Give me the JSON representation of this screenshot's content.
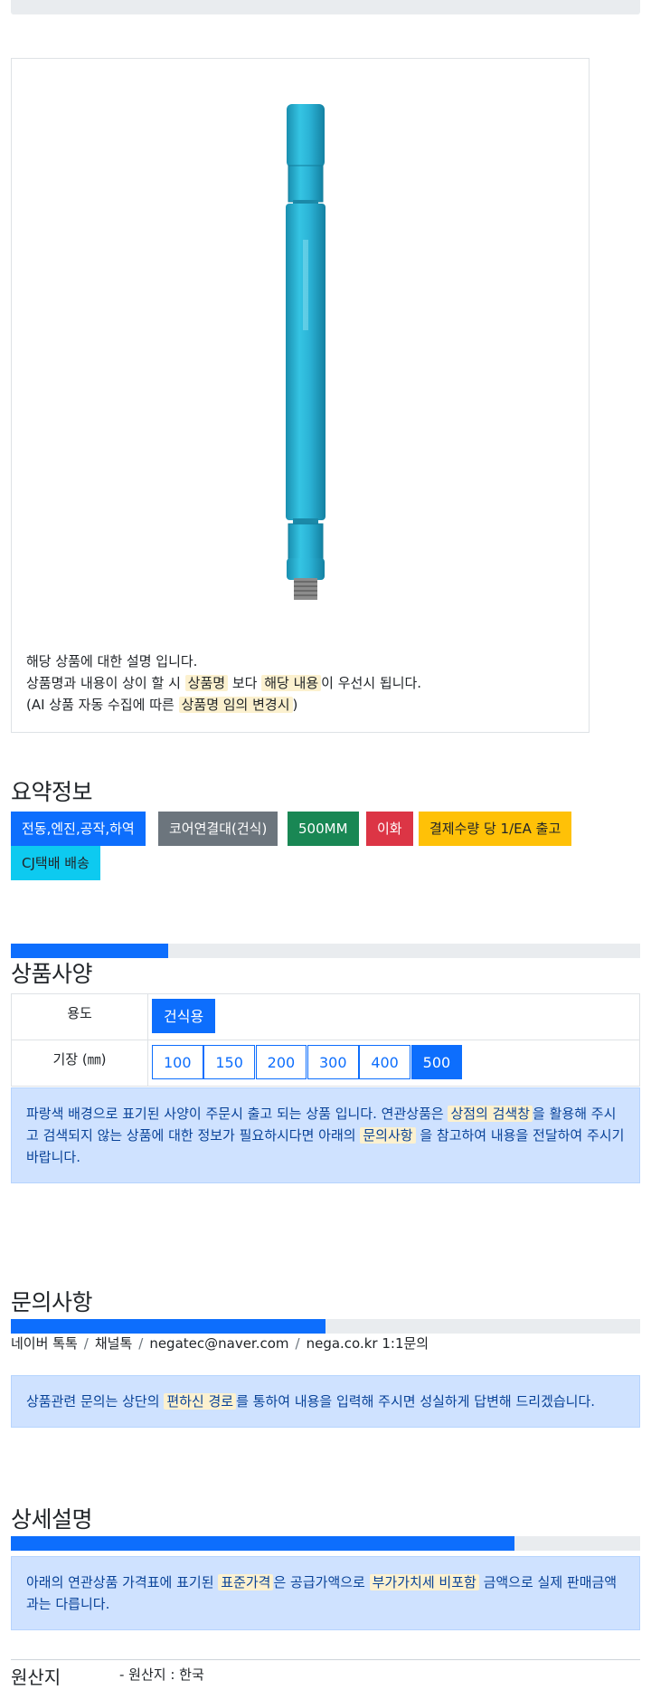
{
  "product_image": {
    "alt": "product-image"
  },
  "description": {
    "line1": "해당 상품에 대한 설명 입니다.",
    "line2_a": "상품명과 내용이 상이 할 시 ",
    "line2_mark1": "상품명",
    "line2_b": " 보다 ",
    "line2_mark2": "해당 내용",
    "line2_c": "이 우선시 됩니다.",
    "line3_a": "(AI 상품 자동 수집에 따른 ",
    "line3_mark": "상품명 임의 변경시",
    "line3_b": ")"
  },
  "summary": {
    "title": "요약정보",
    "badges": [
      {
        "label": "전동,엔진,공작,하역",
        "color": "#0d6efd",
        "text_color": "#ffffff"
      },
      {
        "label": "코어연결대(건식)",
        "color": "#6c757d",
        "text_color": "#ffffff"
      },
      {
        "label": "500MM",
        "color": "#198754",
        "text_color": "#ffffff"
      },
      {
        "label": "이화",
        "color": "#dc3545",
        "text_color": "#ffffff"
      },
      {
        "label": "결제수량 당 1/EA 출고",
        "color": "#ffc107",
        "text_color": "#212529"
      },
      {
        "label": "CJ택배 배송",
        "color": "#0dcaf0",
        "text_color": "#212529"
      }
    ]
  },
  "spec": {
    "progress_percent": 25,
    "title": "상품사양",
    "rows": [
      {
        "label": "용도",
        "options": [
          "건식용"
        ],
        "selected": "건식용"
      },
      {
        "label": "기장 (㎜)",
        "options": [
          "100",
          "150",
          "200",
          "300",
          "400",
          "500"
        ],
        "selected": "500"
      }
    ],
    "notice_a": "파랑색 배경으로 표기된 사양이 주문시 출고 되는 상품 입니다. 연관상품은 ",
    "notice_mark1": "상점의 검색창",
    "notice_b": "을 활용해 주시고 검색되지 않는 상품에 대한 정보가 필요하시다면 아래의 ",
    "notice_mark2": "문의사항",
    "notice_c": " 을 참고하여 내용을 전달하여 주시기 바랍니다."
  },
  "inquiry": {
    "title": "문의사항",
    "progress_percent": 50,
    "contacts": [
      "네이버 톡톡",
      "채널톡",
      "negatec@naver.com",
      "nega.co.kr 1:1문의"
    ],
    "separator": "/",
    "notice_a": "상품관련 문의는 상단의 ",
    "notice_mark": "편하신 경로",
    "notice_b": "를 통하여 내용을 입력해 주시면 성실하게 답변해 드리겠습니다."
  },
  "detail": {
    "title": "상세설명",
    "progress_percent": 80,
    "notice_a": "아래의 연관상품 가격표에 표기된 ",
    "notice_mark1": "표준가격",
    "notice_b": "은 공급가액으로 ",
    "notice_mark2": "부가가치세 비포함",
    "notice_c": " 금액으로 실제 판매금액과는 다릅니다."
  },
  "origin": {
    "label": "원산지",
    "value": "- 원산지 : 한국"
  }
}
